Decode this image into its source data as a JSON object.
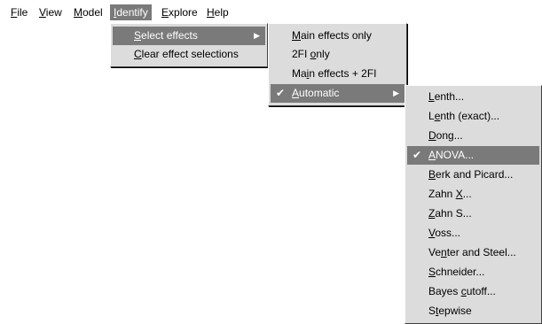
{
  "menubar": {
    "items": [
      {
        "pre": "",
        "mn": "F",
        "post": "ile"
      },
      {
        "pre": "",
        "mn": "V",
        "post": "iew"
      },
      {
        "pre": "",
        "mn": "M",
        "post": "odel"
      },
      {
        "pre": "",
        "mn": "I",
        "post": "dentify"
      },
      {
        "pre": "",
        "mn": "E",
        "post": "xplore"
      },
      {
        "pre": "",
        "mn": "H",
        "post": "elp"
      }
    ]
  },
  "identify_menu": {
    "items": [
      {
        "pre": "",
        "mn": "S",
        "post": "elect effects",
        "arrow": "▶"
      },
      {
        "pre": "",
        "mn": "C",
        "post": "lear effect selections"
      }
    ]
  },
  "select_effects_menu": {
    "items": [
      {
        "pre": "",
        "mn": "M",
        "post": "ain effects only"
      },
      {
        "pre": "2FI ",
        "mn": "o",
        "post": "nly"
      },
      {
        "pre": "Ma",
        "mn": "i",
        "post": "n effects + 2FI"
      },
      {
        "pre": "",
        "mn": "A",
        "post": "utomatic",
        "check": "✔",
        "arrow": "▶"
      }
    ]
  },
  "automatic_menu": {
    "items": [
      {
        "pre": "",
        "mn": "L",
        "post": "enth..."
      },
      {
        "pre": "L",
        "mn": "e",
        "post": "nth (exact)..."
      },
      {
        "pre": "",
        "mn": "D",
        "post": "ong..."
      },
      {
        "pre": "",
        "mn": "A",
        "post": "NOVA...",
        "check": "✔"
      },
      {
        "pre": "",
        "mn": "B",
        "post": "erk and Picard..."
      },
      {
        "pre": "Zahn ",
        "mn": "X",
        "post": "..."
      },
      {
        "pre": "",
        "mn": "Z",
        "post": "ahn S..."
      },
      {
        "pre": "",
        "mn": "V",
        "post": "oss..."
      },
      {
        "pre": "Ve",
        "mn": "n",
        "post": "ter and Steel..."
      },
      {
        "pre": "",
        "mn": "S",
        "post": "chneider..."
      },
      {
        "pre": "Bayes ",
        "mn": "c",
        "post": "utoff..."
      },
      {
        "pre": "S",
        "mn": "t",
        "post": "epwise"
      }
    ]
  }
}
